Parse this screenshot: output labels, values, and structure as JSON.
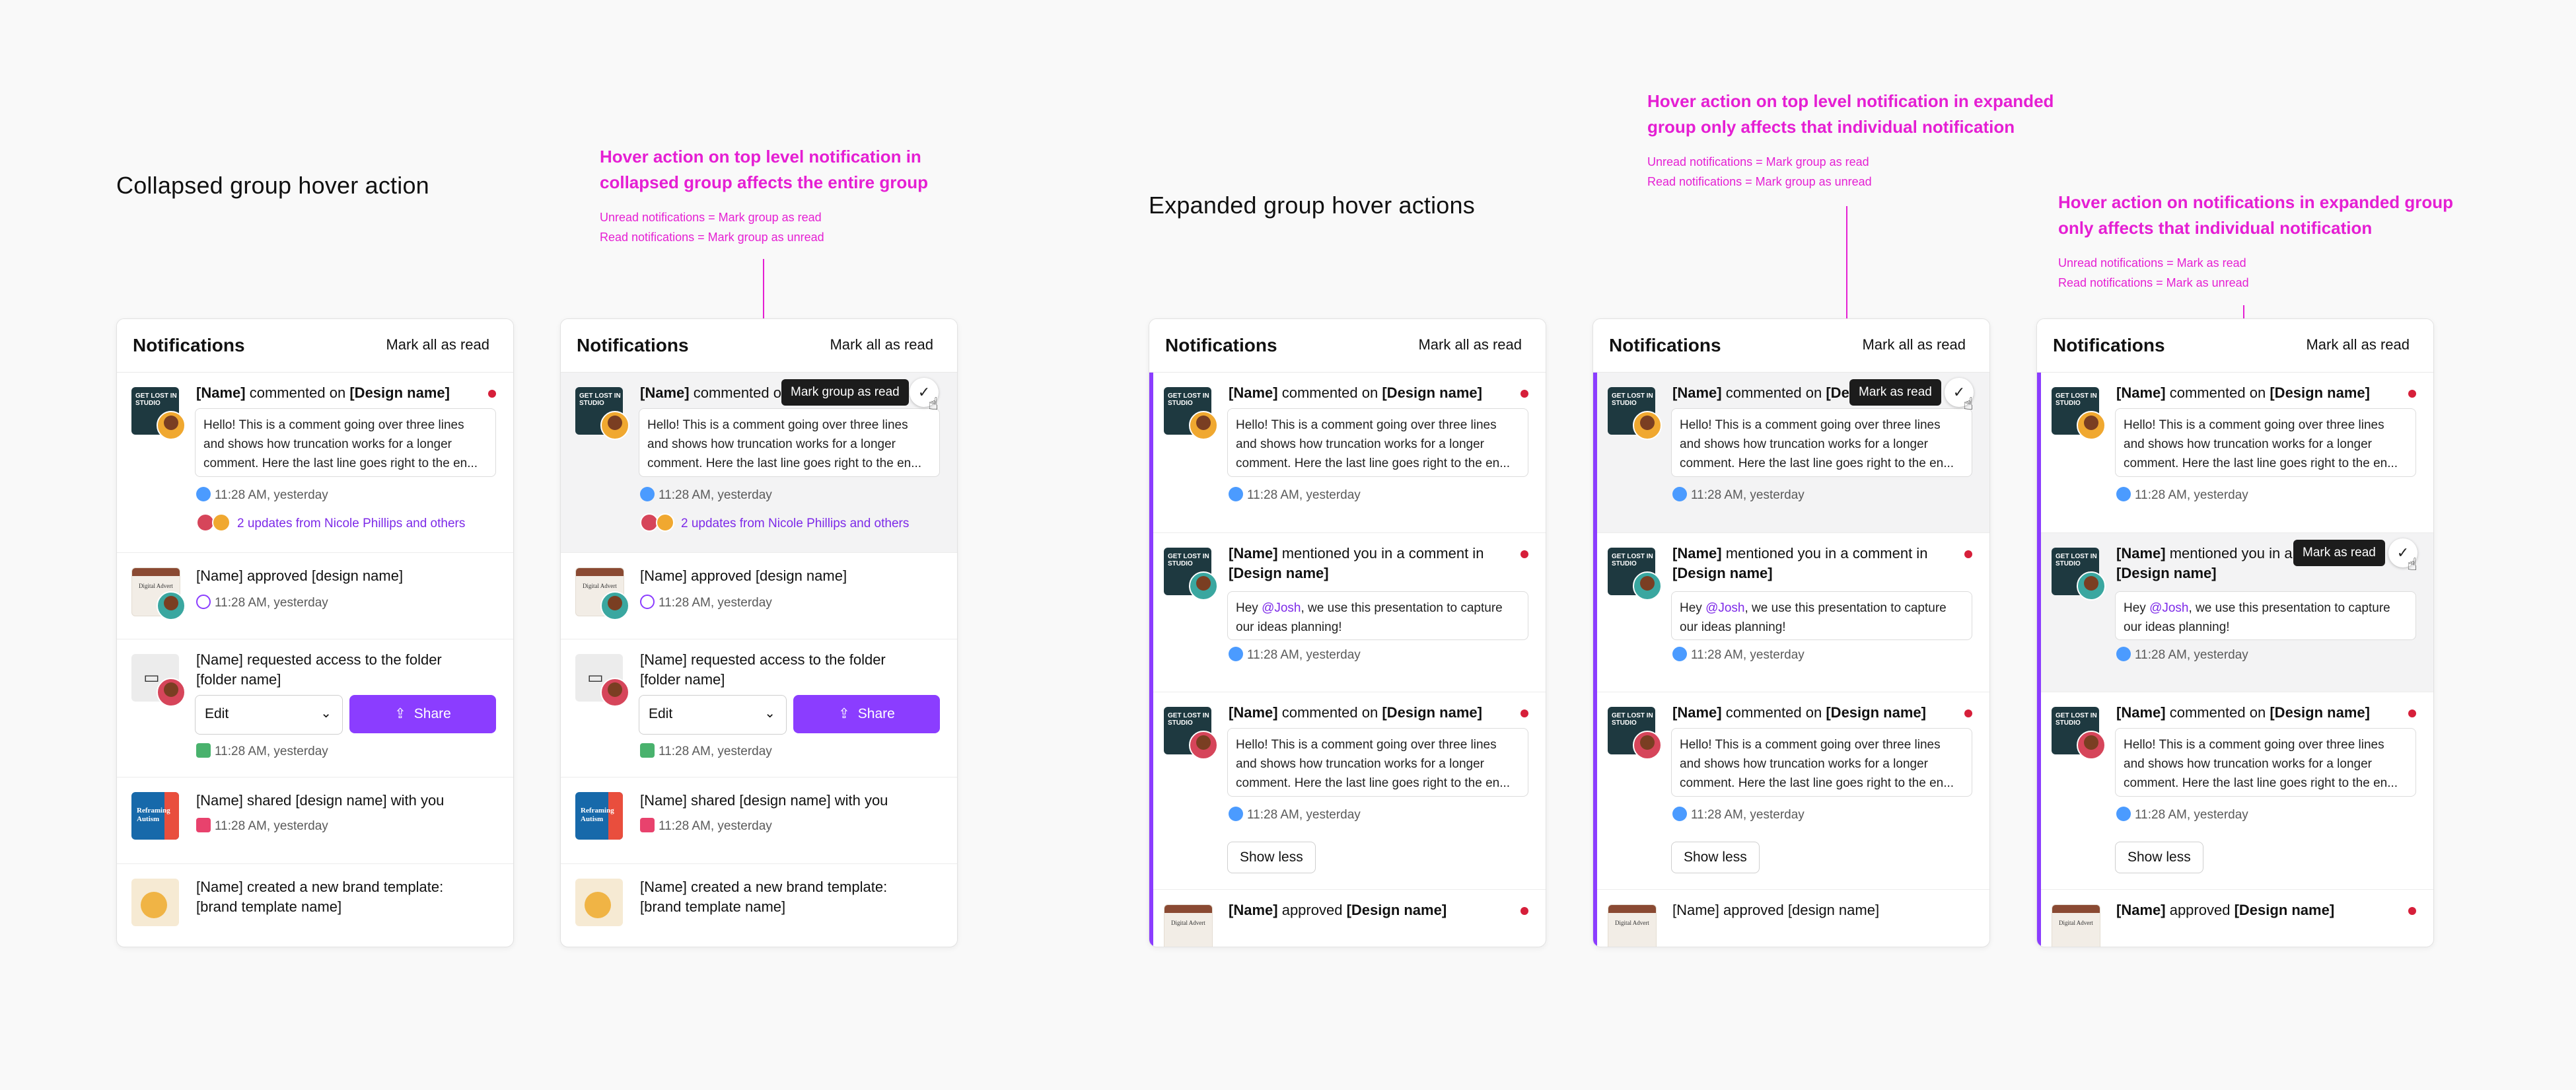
{
  "titles": {
    "collapsed": "Collapsed group hover action",
    "expanded": "Expanded group hover actions"
  },
  "annotations": {
    "a1": {
      "head1": "Hover action on top level notification in",
      "head2": "collapsed group affects the entire group",
      "sub1": "Unread notifications  = Mark group as read",
      "sub2": "Read notifications = Mark group as unread"
    },
    "a2": {
      "head1": "Hover action on top level notification in expanded",
      "head2": "group only affects that individual notification",
      "sub1": "Unread notifications  = Mark group as read",
      "sub2": "Read notifications = Mark group as unread"
    },
    "a3": {
      "head1": "Hover action on notifications in expanded group",
      "head2": "only affects that individual notification",
      "sub1": "Unread notifications  = Mark as read",
      "sub2": "Read notifications = Mark as unread"
    }
  },
  "panel": {
    "title": "Notifications",
    "mark_all": "Mark all as read",
    "name": "[Name]",
    "design_name": "[Design name]",
    "commented_on": "commented on",
    "mentioned": "mentioned you in a comment in",
    "approved": "approved",
    "comment1": "Hello! This is a comment going over three lines",
    "comment2": "and shows how truncation works for a longer",
    "comment3": "comment. Here the last line goes right to the en...",
    "mention_pre": "Hey ",
    "mention_tag": "@Josh",
    "mention_rest1": ", we use this presentation to capture",
    "mention_rest2": "our ideas planning!",
    "time": "11:28 AM, yesterday",
    "updates": "2 updates from Nicole Phillips and others",
    "approved_line": "[Name] approved [design name]",
    "request1": "[Name] requested access to the folder",
    "request2": "[folder name]",
    "edit": "Edit",
    "share": "Share",
    "shared": "[Name] shared [design name] with you",
    "template1": "[Name] created a new brand template:",
    "template2": "[brand template name]",
    "show_less": "Show less",
    "thumb_dark": "GET LOST IN STUDIO",
    "thumb_light": "Digital Advert",
    "thumb_blue": "Reframing Autism"
  },
  "tooltips": {
    "group": "Mark group as read",
    "single": "Mark as read"
  },
  "icons": {
    "check": "✓",
    "cursor": "☝",
    "chevron": "⌄",
    "share": "⇪",
    "folder": "▭"
  },
  "colors": {
    "accent": "#e51fd3",
    "brand": "#8b3dff",
    "unread": "#d61f3a"
  }
}
